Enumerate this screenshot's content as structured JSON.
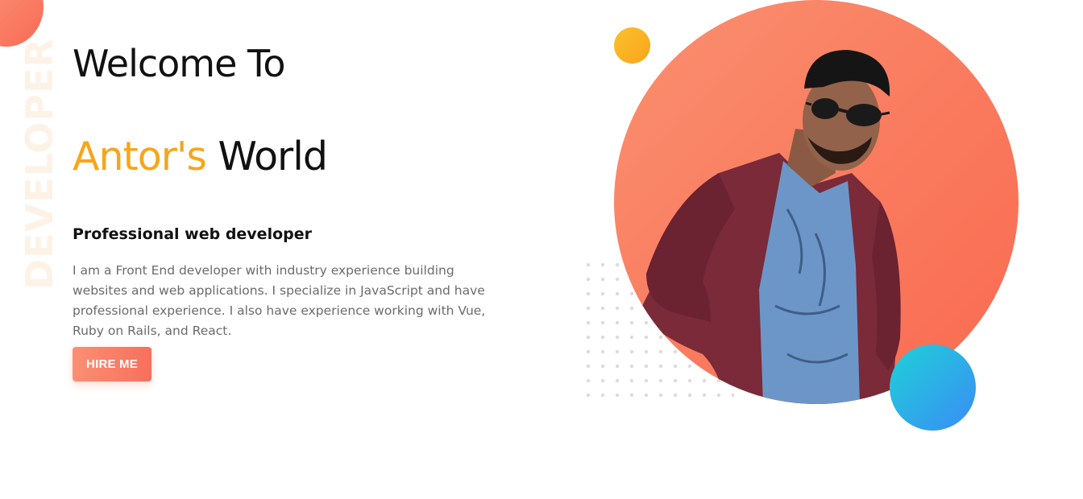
{
  "hero": {
    "vertical_word": "DEVELOPER",
    "title_line1": "Welcome To",
    "title_line2_accent": "Antor's",
    "title_line2_rest": " World",
    "subtitle": "Professional web developer",
    "bio": "I am a Front End developer with industry experience building websites and web applications. I specialize in JavaScript and have professional experience. I also have experience working with Vue, Ruby on Rails, and React.",
    "cta_label": "HIRE ME"
  },
  "colors": {
    "accent": "#f7a51a",
    "button_gradient": [
      "#fb8f73",
      "#f8705c"
    ],
    "portrait_circle": [
      "#fa9070",
      "#f96a50"
    ],
    "blue_dot": [
      "#1fd1d8",
      "#3a8cf5"
    ],
    "yellow_dot": [
      "#fbc02d",
      "#f9a51a"
    ]
  },
  "images": {
    "portrait": "portrait-photo"
  }
}
